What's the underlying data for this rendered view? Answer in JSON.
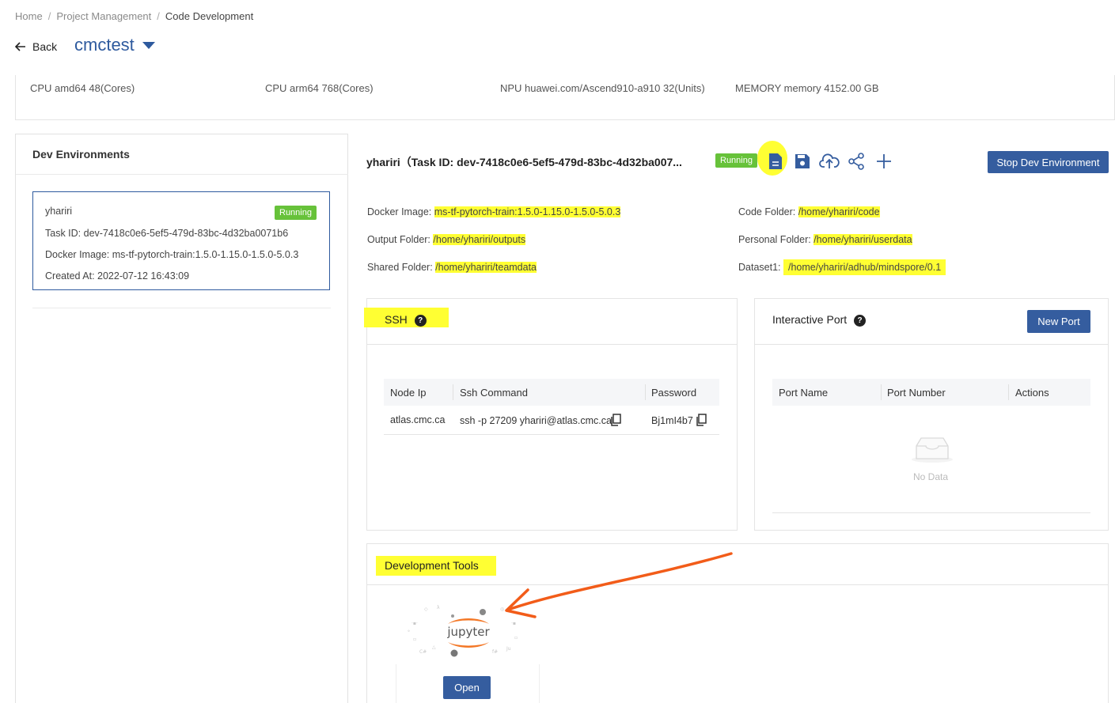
{
  "breadcrumb": {
    "items": [
      "Home",
      "Project Management",
      "Code Development"
    ]
  },
  "header": {
    "back_label": "Back",
    "project_name": "cmctest"
  },
  "resources": [
    {
      "text": "CPU  amd64  48(Cores)"
    },
    {
      "text": "CPU  arm64  768(Cores)"
    },
    {
      "text": "NPU  huawei.com/Ascend910-a910  32(Units)"
    },
    {
      "text": "MEMORY  memory  4152.00 GB"
    }
  ],
  "sidebar": {
    "title": "Dev Environments",
    "env": {
      "name": "yhariri",
      "status": "Running",
      "task_id": "Task ID:  dev-7418c0e6-5ef5-479d-83bc-4d32ba0071b6",
      "docker_image": "Docker Image:  ms-tf-pytorch-train:1.5.0-1.15.0-1.5.0-5.0.3",
      "created_at": "Created At:  2022-07-12 16:43:09"
    }
  },
  "detail": {
    "title": "yhariri（Task ID:  dev-7418c0e6-5ef5-479d-83bc-4d32ba007...",
    "status": "Running",
    "stop_button": "Stop Dev Environment",
    "toolbar_icons": [
      "file-icon",
      "save-icon",
      "cloud-upload-icon",
      "share-icon",
      "plus-icon"
    ],
    "fields": {
      "docker_image_label": "Docker Image:",
      "docker_image_value": "ms-tf-pytorch-train:1.5.0-1.15.0-1.5.0-5.0.3",
      "output_folder_label": "Output Folder:",
      "output_folder_value": "/home/yhariri/outputs",
      "shared_folder_label": "Shared Folder:",
      "shared_folder_value": "/home/yhariri/teamdata",
      "code_folder_label": "Code Folder:",
      "code_folder_value": "/home/yhariri/code",
      "personal_folder_label": "Personal Folder:",
      "personal_folder_value": "/home/yhariri/userdata",
      "dataset1_label": "Dataset1:",
      "dataset1_value": "/home/yhariri/adhub/mindspore/0.1"
    }
  },
  "ssh": {
    "title": "SSH",
    "columns": [
      "Node Ip",
      "Ssh Command",
      "Password"
    ],
    "row": {
      "node_ip": "atlas.cmc.ca",
      "command": "ssh -p 27209 yhariri@atlas.cmc.ca",
      "password": "Bj1mI4b7"
    }
  },
  "ports": {
    "title": "Interactive Port",
    "new_port_button": "New Port",
    "columns": [
      "Port Name",
      "Port Number",
      "Actions"
    ],
    "empty_text": "No Data"
  },
  "dev_tools": {
    "title": "Development Tools",
    "tool_name": "jupyter",
    "open_button": "Open"
  },
  "colors": {
    "primary": "#355d9f",
    "running": "#67c23a",
    "highlight": "#ffff33",
    "annotation_arrow": "#f25c19",
    "jupyter_orange": "#f37726"
  }
}
